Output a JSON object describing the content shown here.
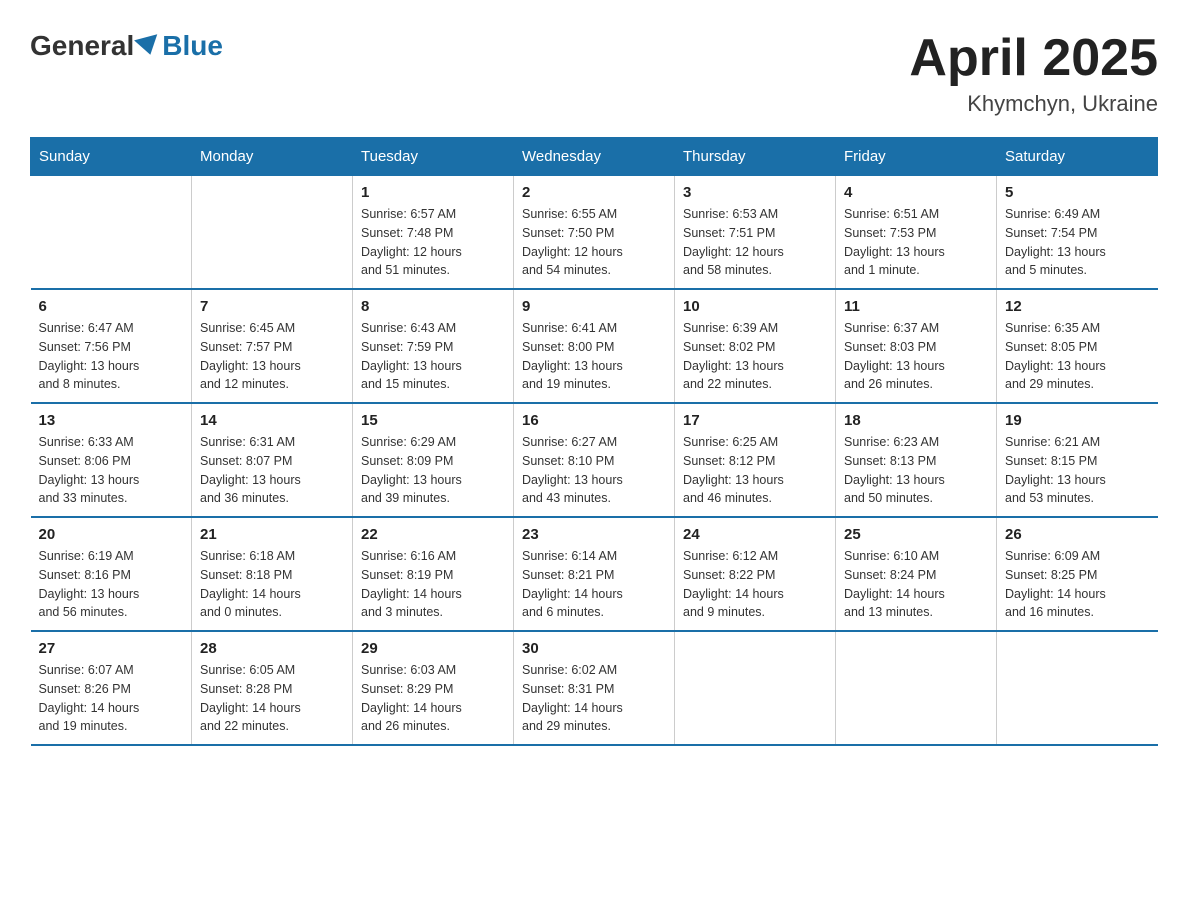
{
  "header": {
    "logo_general": "General",
    "logo_blue": "Blue",
    "month_year": "April 2025",
    "location": "Khymchyn, Ukraine"
  },
  "days_of_week": [
    "Sunday",
    "Monday",
    "Tuesday",
    "Wednesday",
    "Thursday",
    "Friday",
    "Saturday"
  ],
  "weeks": [
    [
      {
        "day": "",
        "info": ""
      },
      {
        "day": "",
        "info": ""
      },
      {
        "day": "1",
        "info": "Sunrise: 6:57 AM\nSunset: 7:48 PM\nDaylight: 12 hours\nand 51 minutes."
      },
      {
        "day": "2",
        "info": "Sunrise: 6:55 AM\nSunset: 7:50 PM\nDaylight: 12 hours\nand 54 minutes."
      },
      {
        "day": "3",
        "info": "Sunrise: 6:53 AM\nSunset: 7:51 PM\nDaylight: 12 hours\nand 58 minutes."
      },
      {
        "day": "4",
        "info": "Sunrise: 6:51 AM\nSunset: 7:53 PM\nDaylight: 13 hours\nand 1 minute."
      },
      {
        "day": "5",
        "info": "Sunrise: 6:49 AM\nSunset: 7:54 PM\nDaylight: 13 hours\nand 5 minutes."
      }
    ],
    [
      {
        "day": "6",
        "info": "Sunrise: 6:47 AM\nSunset: 7:56 PM\nDaylight: 13 hours\nand 8 minutes."
      },
      {
        "day": "7",
        "info": "Sunrise: 6:45 AM\nSunset: 7:57 PM\nDaylight: 13 hours\nand 12 minutes."
      },
      {
        "day": "8",
        "info": "Sunrise: 6:43 AM\nSunset: 7:59 PM\nDaylight: 13 hours\nand 15 minutes."
      },
      {
        "day": "9",
        "info": "Sunrise: 6:41 AM\nSunset: 8:00 PM\nDaylight: 13 hours\nand 19 minutes."
      },
      {
        "day": "10",
        "info": "Sunrise: 6:39 AM\nSunset: 8:02 PM\nDaylight: 13 hours\nand 22 minutes."
      },
      {
        "day": "11",
        "info": "Sunrise: 6:37 AM\nSunset: 8:03 PM\nDaylight: 13 hours\nand 26 minutes."
      },
      {
        "day": "12",
        "info": "Sunrise: 6:35 AM\nSunset: 8:05 PM\nDaylight: 13 hours\nand 29 minutes."
      }
    ],
    [
      {
        "day": "13",
        "info": "Sunrise: 6:33 AM\nSunset: 8:06 PM\nDaylight: 13 hours\nand 33 minutes."
      },
      {
        "day": "14",
        "info": "Sunrise: 6:31 AM\nSunset: 8:07 PM\nDaylight: 13 hours\nand 36 minutes."
      },
      {
        "day": "15",
        "info": "Sunrise: 6:29 AM\nSunset: 8:09 PM\nDaylight: 13 hours\nand 39 minutes."
      },
      {
        "day": "16",
        "info": "Sunrise: 6:27 AM\nSunset: 8:10 PM\nDaylight: 13 hours\nand 43 minutes."
      },
      {
        "day": "17",
        "info": "Sunrise: 6:25 AM\nSunset: 8:12 PM\nDaylight: 13 hours\nand 46 minutes."
      },
      {
        "day": "18",
        "info": "Sunrise: 6:23 AM\nSunset: 8:13 PM\nDaylight: 13 hours\nand 50 minutes."
      },
      {
        "day": "19",
        "info": "Sunrise: 6:21 AM\nSunset: 8:15 PM\nDaylight: 13 hours\nand 53 minutes."
      }
    ],
    [
      {
        "day": "20",
        "info": "Sunrise: 6:19 AM\nSunset: 8:16 PM\nDaylight: 13 hours\nand 56 minutes."
      },
      {
        "day": "21",
        "info": "Sunrise: 6:18 AM\nSunset: 8:18 PM\nDaylight: 14 hours\nand 0 minutes."
      },
      {
        "day": "22",
        "info": "Sunrise: 6:16 AM\nSunset: 8:19 PM\nDaylight: 14 hours\nand 3 minutes."
      },
      {
        "day": "23",
        "info": "Sunrise: 6:14 AM\nSunset: 8:21 PM\nDaylight: 14 hours\nand 6 minutes."
      },
      {
        "day": "24",
        "info": "Sunrise: 6:12 AM\nSunset: 8:22 PM\nDaylight: 14 hours\nand 9 minutes."
      },
      {
        "day": "25",
        "info": "Sunrise: 6:10 AM\nSunset: 8:24 PM\nDaylight: 14 hours\nand 13 minutes."
      },
      {
        "day": "26",
        "info": "Sunrise: 6:09 AM\nSunset: 8:25 PM\nDaylight: 14 hours\nand 16 minutes."
      }
    ],
    [
      {
        "day": "27",
        "info": "Sunrise: 6:07 AM\nSunset: 8:26 PM\nDaylight: 14 hours\nand 19 minutes."
      },
      {
        "day": "28",
        "info": "Sunrise: 6:05 AM\nSunset: 8:28 PM\nDaylight: 14 hours\nand 22 minutes."
      },
      {
        "day": "29",
        "info": "Sunrise: 6:03 AM\nSunset: 8:29 PM\nDaylight: 14 hours\nand 26 minutes."
      },
      {
        "day": "30",
        "info": "Sunrise: 6:02 AM\nSunset: 8:31 PM\nDaylight: 14 hours\nand 29 minutes."
      },
      {
        "day": "",
        "info": ""
      },
      {
        "day": "",
        "info": ""
      },
      {
        "day": "",
        "info": ""
      }
    ]
  ]
}
